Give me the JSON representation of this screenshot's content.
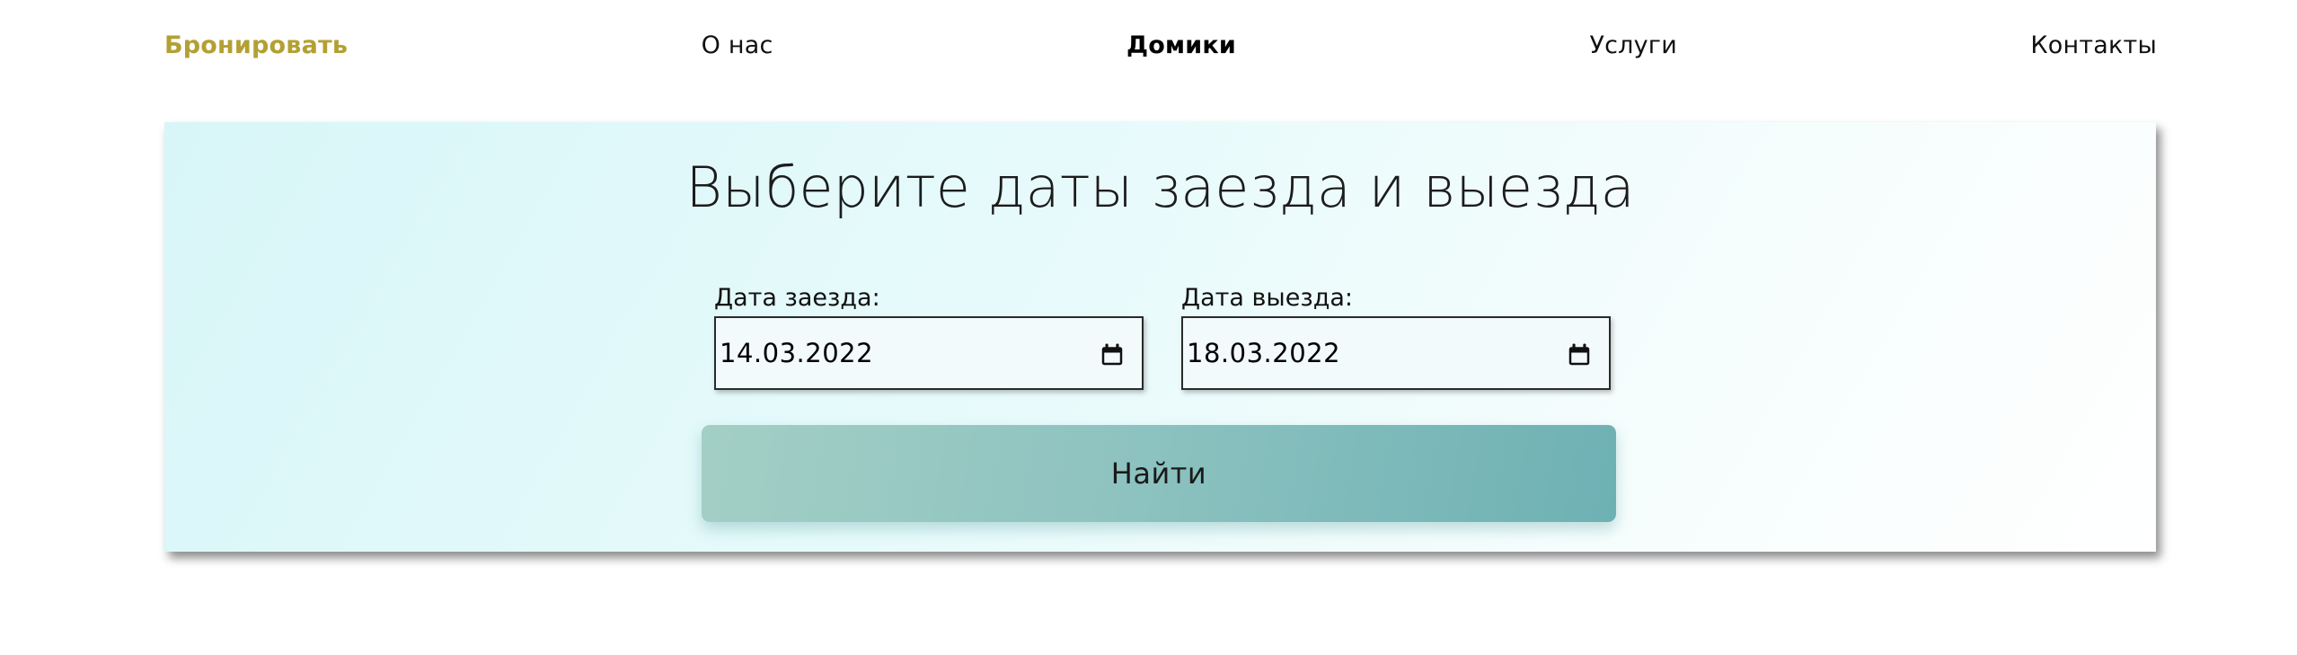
{
  "nav": {
    "book": "Бронировать",
    "about": "О нас",
    "houses": "Домики",
    "services": "Услуги",
    "contacts": "Контакты"
  },
  "booking": {
    "title": "Выберите даты заезда и выезда",
    "checkin_label": "Дата заезда:",
    "checkin_value": "14.03.2022",
    "checkout_label": "Дата выезда:",
    "checkout_value": "18.03.2022",
    "search_label": "Найти"
  },
  "icons": {
    "checkin_icon": "calendar-icon",
    "checkout_icon": "calendar-icon"
  },
  "colors": {
    "brand": "#b3a033",
    "button_start": "#a3cfc5",
    "button_end": "#6eb1b4",
    "panel_bg": "#e0f7f8"
  }
}
